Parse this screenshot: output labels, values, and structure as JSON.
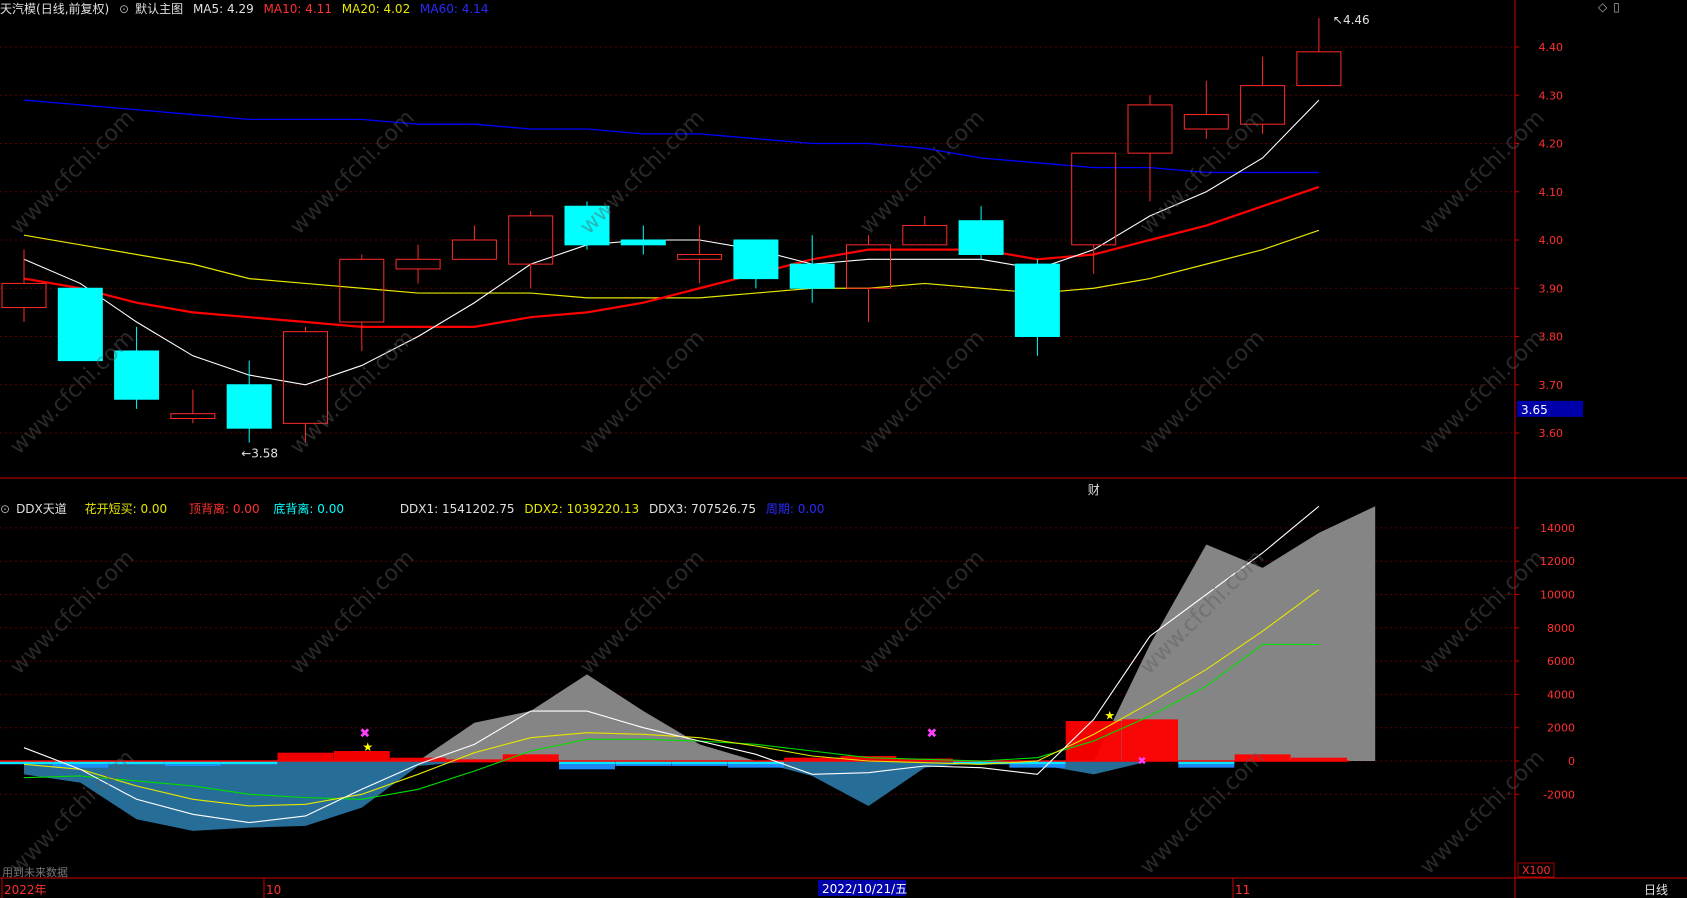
{
  "header": {
    "stock_name": "天汽模",
    "period": "(日线,前复权)",
    "indicator_name": "默认主图",
    "ma5_label": "MA5: 4.29",
    "ma10_label": "MA10: 4.11",
    "ma20_label": "MA20: 4.02",
    "ma60_label": "MA60: 4.14"
  },
  "sub_header": {
    "indicator_name": "DDX天道",
    "hk_label": "花开短买: 0.00",
    "top_div_label": "顶背离: 0.00",
    "bottom_div_label": "底背离: 0.00",
    "ddx1_label": "DDX1: 1541202.75",
    "ddx2_label": "DDX2: 1039220.13",
    "ddx3_label": "DDX3: 707526.75",
    "other_label": "周期: 0.00"
  },
  "colors": {
    "up": "#ff2a2a",
    "down": "#00ffff",
    "ma5": "#ffffff",
    "ma10": "#ff0000",
    "ma20": "#e6e600",
    "ma60": "#0000ff",
    "axis": "#cc0000",
    "ddx_area": "#8c8c8c",
    "ddx_neg_area": "#2a7aa8"
  },
  "price_panel": {
    "high_label": "4.46",
    "low_label": "3.58",
    "current_price": "3.65",
    "cai_label": "财"
  },
  "ddx_panel": {
    "future_data_label": "用到未来数据",
    "scale_label": "X100"
  },
  "x_labels": {
    "year": "2022年",
    "oct": "10",
    "date": "2022/10/21/五",
    "nov": "11",
    "period_button": "日线"
  },
  "chart_data": [
    {
      "type": "candlestick",
      "ylim": [
        3.55,
        4.48
      ],
      "yticks": [
        "4.40",
        "4.30",
        "4.20",
        "4.10",
        "4.00",
        "3.90",
        "3.80",
        "3.70",
        "3.60"
      ],
      "candles": [
        {
          "o": 3.86,
          "c": 3.91,
          "h": 3.98,
          "l": 3.83
        },
        {
          "o": 3.9,
          "c": 3.75,
          "h": 3.9,
          "l": 3.75
        },
        {
          "o": 3.77,
          "c": 3.67,
          "h": 3.82,
          "l": 3.65
        },
        {
          "o": 3.63,
          "c": 3.64,
          "h": 3.69,
          "l": 3.62
        },
        {
          "o": 3.7,
          "c": 3.61,
          "h": 3.75,
          "l": 3.58
        },
        {
          "o": 3.62,
          "c": 3.81,
          "h": 3.82,
          "l": 3.58
        },
        {
          "o": 3.83,
          "c": 3.96,
          "h": 3.97,
          "l": 3.77
        },
        {
          "o": 3.94,
          "c": 3.96,
          "h": 3.99,
          "l": 3.91
        },
        {
          "o": 3.96,
          "c": 4.0,
          "h": 4.03,
          "l": 3.96
        },
        {
          "o": 3.95,
          "c": 4.05,
          "h": 4.06,
          "l": 3.9
        },
        {
          "o": 4.07,
          "c": 3.99,
          "h": 4.08,
          "l": 3.98
        },
        {
          "o": 4.0,
          "c": 3.99,
          "h": 4.03,
          "l": 3.97
        },
        {
          "o": 3.96,
          "c": 3.97,
          "h": 4.03,
          "l": 3.91
        },
        {
          "o": 4.0,
          "c": 3.92,
          "h": 4.0,
          "l": 3.9
        },
        {
          "o": 3.95,
          "c": 3.9,
          "h": 4.01,
          "l": 3.87
        },
        {
          "o": 3.9,
          "c": 3.99,
          "h": 4.01,
          "l": 3.83
        },
        {
          "o": 3.99,
          "c": 4.03,
          "h": 4.05,
          "l": 3.99
        },
        {
          "o": 4.04,
          "c": 3.97,
          "h": 4.07,
          "l": 3.96
        },
        {
          "o": 3.95,
          "c": 3.8,
          "h": 3.96,
          "l": 3.76
        },
        {
          "o": 3.99,
          "c": 4.18,
          "h": 4.18,
          "l": 3.93
        },
        {
          "o": 4.18,
          "c": 4.28,
          "h": 4.3,
          "l": 4.08
        },
        {
          "o": 4.23,
          "c": 4.26,
          "h": 4.33,
          "l": 4.21
        },
        {
          "o": 4.24,
          "c": 4.32,
          "h": 4.38,
          "l": 4.22
        },
        {
          "o": 4.32,
          "c": 4.39,
          "h": 4.46,
          "l": 4.32
        }
      ],
      "ma5": [
        3.96,
        3.91,
        3.83,
        3.76,
        3.72,
        3.7,
        3.74,
        3.8,
        3.87,
        3.95,
        3.99,
        4.0,
        4.0,
        3.98,
        3.95,
        3.96,
        3.96,
        3.96,
        3.94,
        3.98,
        4.05,
        4.1,
        4.17,
        4.29
      ],
      "ma10": [
        3.92,
        3.9,
        3.87,
        3.85,
        3.84,
        3.83,
        3.82,
        3.82,
        3.82,
        3.84,
        3.85,
        3.87,
        3.9,
        3.93,
        3.96,
        3.98,
        3.98,
        3.98,
        3.96,
        3.97,
        4.0,
        4.03,
        4.07,
        4.11
      ],
      "ma20": [
        4.01,
        3.99,
        3.97,
        3.95,
        3.92,
        3.91,
        3.9,
        3.89,
        3.89,
        3.89,
        3.88,
        3.88,
        3.88,
        3.89,
        3.9,
        3.9,
        3.91,
        3.9,
        3.89,
        3.9,
        3.92,
        3.95,
        3.98,
        4.02
      ],
      "ma60": [
        4.29,
        4.28,
        4.27,
        4.26,
        4.25,
        4.25,
        4.25,
        4.24,
        4.24,
        4.23,
        4.23,
        4.22,
        4.22,
        4.21,
        4.2,
        4.2,
        4.19,
        4.17,
        4.16,
        4.15,
        4.15,
        4.14,
        4.14,
        4.14
      ]
    },
    {
      "type": "area",
      "ylim": [
        -4500,
        15500
      ],
      "yticks": [
        "14000",
        "12000",
        "10000",
        "8000",
        "6000",
        "4000",
        "2000",
        "0",
        "-2000"
      ],
      "ddx_area": [
        -800,
        -1300,
        -3500,
        -4200,
        -4000,
        -3900,
        -2800,
        -300,
        2300,
        3000,
        5200,
        3000,
        1000,
        0,
        -900,
        -2700,
        -400,
        -100,
        -200,
        -800,
        7000,
        13000,
        11600,
        13700,
        15300
      ],
      "ddx1": [
        800,
        -500,
        -2300,
        -3200,
        -3700,
        -3300,
        -1700,
        -200,
        1000,
        3000,
        3000,
        2000,
        1200,
        400,
        -800,
        -700,
        -300,
        -400,
        -800,
        2500,
        7500,
        10000,
        12500,
        15300
      ],
      "ddx2": [
        -200,
        -500,
        -1500,
        -2300,
        -2700,
        -2600,
        -2000,
        -800,
        500,
        1400,
        1700,
        1600,
        1400,
        900,
        300,
        0,
        -100,
        -200,
        0,
        1600,
        3500,
        5500,
        7800,
        10300
      ],
      "ddx3": [
        -1000,
        -900,
        -1200,
        -1500,
        -2000,
        -2200,
        -2300,
        -1700,
        -600,
        600,
        1300,
        1300,
        1200,
        1000,
        600,
        200,
        100,
        0,
        200,
        1200,
        2700,
        4500,
        7000,
        7000
      ],
      "bars": [
        -200,
        -400,
        -200,
        -300,
        -200,
        500,
        600,
        200,
        100,
        400,
        -500,
        -300,
        -300,
        -400,
        200,
        300,
        150,
        -200,
        -400,
        2400,
        2500,
        -400,
        400,
        200
      ]
    }
  ]
}
